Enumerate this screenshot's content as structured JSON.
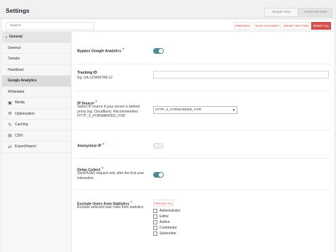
{
  "header": {
    "title": "Settings",
    "views": [
      "Simple View",
      "Advanced View"
    ]
  },
  "actionbar": {
    "search_placeholder": "Search",
    "preview": "PREVIEW",
    "save": "SAVE CHANGES",
    "reset_section": "RESET SECTION",
    "reset_all": "RESET ALL"
  },
  "sidebar": {
    "items": [
      {
        "label": "General",
        "type": "group",
        "icon": "caret-icon"
      },
      {
        "label": "General",
        "type": "sub"
      },
      {
        "label": "Tweaks",
        "type": "sub"
      },
      {
        "label": "Heartbeat",
        "type": "sub"
      },
      {
        "label": "Google Analytics",
        "type": "active"
      },
      {
        "label": "Whitelabel",
        "type": "sub"
      },
      {
        "label": "Media",
        "type": "item",
        "icon": "media-icon"
      },
      {
        "label": "Optimization",
        "type": "item",
        "icon": "optimization-icon"
      },
      {
        "label": "Caching",
        "type": "item",
        "icon": "caching-icon"
      },
      {
        "label": "CDN",
        "type": "item",
        "icon": "cdn-icon"
      },
      {
        "label": "Export/Import",
        "type": "item",
        "icon": "export-import-icon"
      }
    ]
  },
  "settings": {
    "bypass": {
      "label": "Bypass Google Analytics",
      "help": "?",
      "enabled": true
    },
    "tracking": {
      "label": "Tracking ID",
      "desc": "Eg: UA-123456789-12",
      "value": ""
    },
    "ip_source": {
      "label": "IP Source",
      "help": "?",
      "desc": [
        "Select IP source if your server is behind",
        "proxy (eg: Cloudflare). Recommended:",
        "HTTP_X_FORWARDED_FOR"
      ],
      "value": "HTTP_X_FORWARDED_FOR"
    },
    "anonymize": {
      "label": "Anonymize IP",
      "help": "?",
      "enabled": false
    },
    "delay": {
      "label": "Delay Collect",
      "help": "?",
      "desc": [
        "Send AJAX request only after the first user",
        "interaction"
      ],
      "enabled": true
    },
    "exclude": {
      "label": "Exclude Users from Statistics",
      "help": "?",
      "desc": "Exclude selected user roles from statistics",
      "toggle_all": "TOGGLE ALL",
      "roles": [
        "Administrator",
        "Editor",
        "Author",
        "Contributor",
        "Subscriber"
      ]
    }
  },
  "colors": {
    "accent": "#d54e4e",
    "toggle_on": "#4e8b93",
    "help": "#0073aa"
  }
}
